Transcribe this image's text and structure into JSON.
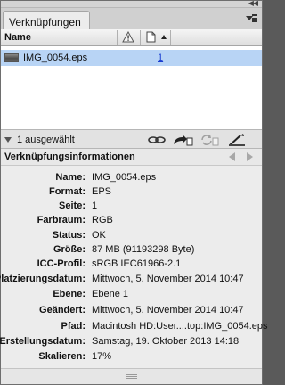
{
  "panel": {
    "tab_title": "Verknüpfungen"
  },
  "columns": {
    "name_header": "Name",
    "status_icon": "warning-triangle-icon",
    "page_icon": "page-icon"
  },
  "links": [
    {
      "name": "IMG_0054.eps",
      "page": "1",
      "thumbnail_icon": "image-thumbnail"
    }
  ],
  "status_bar": {
    "selection_text": "1 ausgewählt",
    "tools": [
      "relink-icon",
      "goto-link-icon",
      "update-link-icon",
      "edit-original-icon"
    ]
  },
  "info_section": {
    "title": "Verknüpfungsinformationen",
    "rows": [
      {
        "label": "Name:",
        "value": "IMG_0054.eps"
      },
      {
        "label": "Format:",
        "value": "EPS"
      },
      {
        "label": "Seite:",
        "value": "1"
      },
      {
        "label": "Farbraum:",
        "value": "RGB"
      },
      {
        "label": "Status:",
        "value": "OK"
      },
      {
        "label": "Größe:",
        "value": "87 MB (91193298 Byte)"
      },
      {
        "label": "ICC-Profil:",
        "value": "sRGB IEC61966-2.1"
      },
      {
        "label": "Platzierungsdatum:",
        "value": "Mittwoch, 5. November 2014 10:47"
      },
      {
        "label": "Ebene:",
        "value": "Ebene 1"
      },
      {
        "label": "Geändert:",
        "value": "Mittwoch, 5. November 2014 10:47"
      },
      {
        "label": "Pfad:",
        "value": "Macintosh HD:User....top:IMG_0054.eps"
      },
      {
        "label": "Erstellungsdatum:",
        "value": "Samstag, 19. Oktober 2013 14:18"
      },
      {
        "label": "Skalieren:",
        "value": "17%"
      }
    ]
  },
  "colors": {
    "selection": "#b8d4f5",
    "link_blue": "#1a3dd0",
    "panel_bg": "#ececec"
  }
}
